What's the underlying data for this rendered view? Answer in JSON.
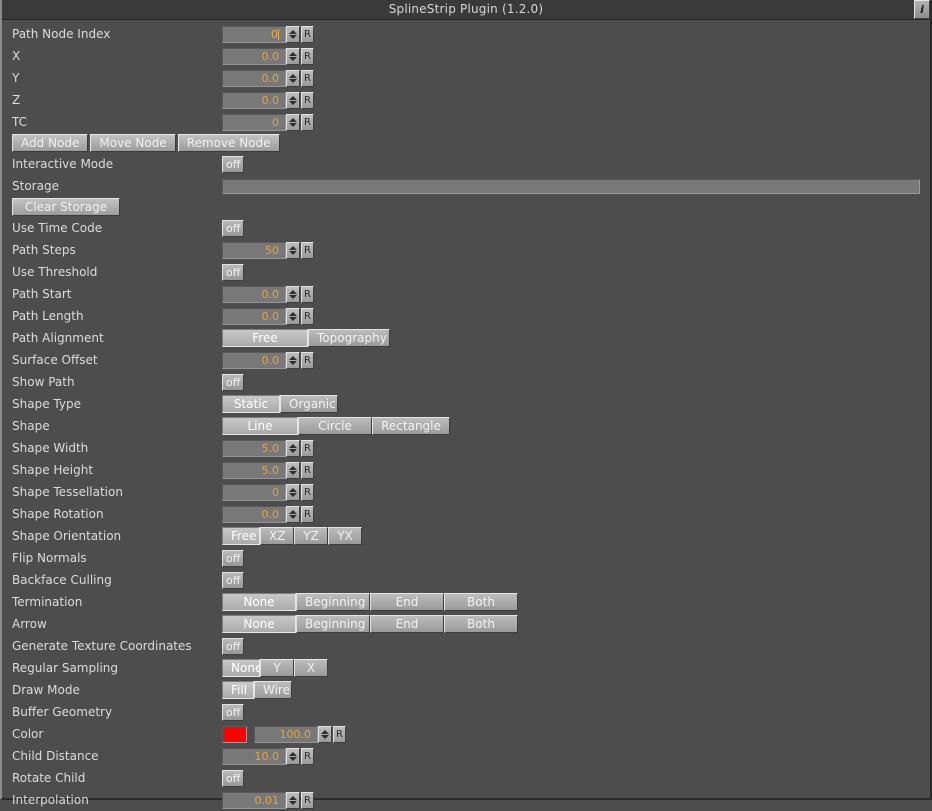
{
  "window": {
    "title": "SplineStrip Plugin (1.2.0)",
    "info_icon_label": "i"
  },
  "accent": {
    "value_text": "#e8a33d",
    "color_swatch": "#fe0000",
    "panel_bg": "#4d4d4d",
    "titlebar_bg": "#3a3a3a"
  },
  "rows": {
    "path_node_index": {
      "label": "Path Node Index",
      "value": "0"
    },
    "x": {
      "label": "X",
      "value": "0.0"
    },
    "y": {
      "label": "Y",
      "value": "0.0"
    },
    "z": {
      "label": "Z",
      "value": "0.0"
    },
    "tc": {
      "label": "TC",
      "value": "0"
    },
    "node_buttons": {
      "add": "Add Node",
      "move": "Move Node",
      "remove": "Remove Node"
    },
    "interactive_mode": {
      "label": "Interactive Mode",
      "value": "off"
    },
    "storage": {
      "label": "Storage",
      "value": ""
    },
    "clear_storage": {
      "label": "Clear Storage"
    },
    "use_time_code": {
      "label": "Use Time Code",
      "value": "off"
    },
    "path_steps": {
      "label": "Path Steps",
      "value": "50"
    },
    "use_threshold": {
      "label": "Use Threshold",
      "value": "off"
    },
    "path_start": {
      "label": "Path Start",
      "value": "0.0"
    },
    "path_length": {
      "label": "Path Length",
      "value": "0.0"
    },
    "path_alignment": {
      "label": "Path Alignment",
      "options": [
        "Free",
        "Topography"
      ],
      "selected": "Free"
    },
    "surface_offset": {
      "label": "Surface Offset",
      "value": "0.0"
    },
    "show_path": {
      "label": "Show Path",
      "value": "off"
    },
    "shape_type": {
      "label": "Shape Type",
      "options": [
        "Static",
        "Organic"
      ],
      "selected": "Static"
    },
    "shape": {
      "label": "Shape",
      "options": [
        "Line",
        "Circle",
        "Rectangle"
      ],
      "selected": "Line"
    },
    "shape_width": {
      "label": "Shape Width",
      "value": "5.0"
    },
    "shape_height": {
      "label": "Shape Height",
      "value": "5.0"
    },
    "shape_tessellation": {
      "label": "Shape Tessellation",
      "value": "0"
    },
    "shape_rotation": {
      "label": "Shape Rotation",
      "value": "0.0"
    },
    "shape_orientation": {
      "label": "Shape Orientation",
      "options": [
        "Free",
        "XZ",
        "YZ",
        "YX"
      ],
      "selected": "Free"
    },
    "flip_normals": {
      "label": "Flip Normals",
      "value": "off"
    },
    "backface_culling": {
      "label": "Backface Culling",
      "value": "off"
    },
    "termination": {
      "label": "Termination",
      "options": [
        "None",
        "Beginning",
        "End",
        "Both"
      ],
      "selected": "None"
    },
    "arrow": {
      "label": "Arrow",
      "options": [
        "None",
        "Beginning",
        "End",
        "Both"
      ],
      "selected": "None"
    },
    "generate_texture_coordinates": {
      "label": "Generate Texture Coordinates",
      "value": "off"
    },
    "regular_sampling": {
      "label": "Regular Sampling",
      "options": [
        "None",
        "Y",
        "X"
      ],
      "selected": "None"
    },
    "draw_mode": {
      "label": "Draw Mode",
      "options": [
        "Fill",
        "Wire"
      ],
      "selected": "Fill"
    },
    "buffer_geometry": {
      "label": "Buffer Geometry",
      "value": "off"
    },
    "color": {
      "label": "Color",
      "value": "100.0"
    },
    "child_distance": {
      "label": "Child Distance",
      "value": "10.0"
    },
    "rotate_child": {
      "label": "Rotate Child",
      "value": "off"
    },
    "interpolation": {
      "label": "Interpolation",
      "value": "0.01"
    }
  },
  "icons": {
    "spin_up": "spinner-up-arrow",
    "spin_down": "spinner-down-arrow",
    "reset": "R"
  }
}
